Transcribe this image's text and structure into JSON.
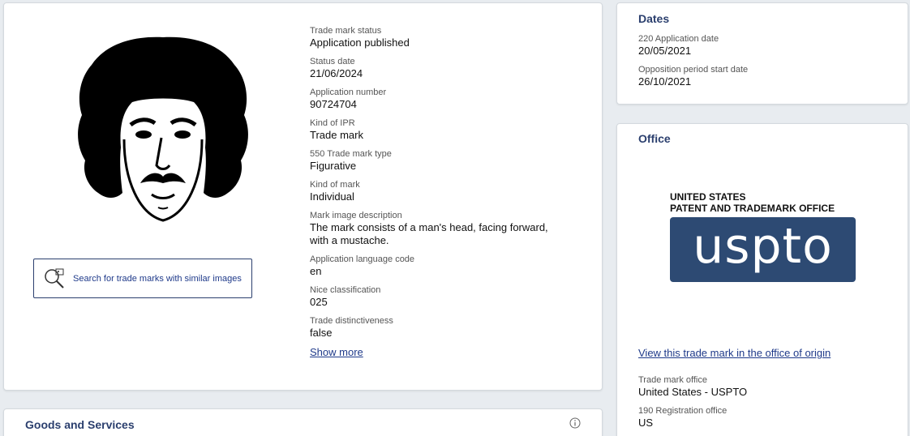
{
  "main_details": {
    "fields": [
      {
        "label": "Trade mark status",
        "value": "Application published"
      },
      {
        "label": "Status date",
        "value": "21/06/2024"
      },
      {
        "label": "Application number",
        "value": "90724704"
      },
      {
        "label": "Kind of IPR",
        "value": "Trade mark"
      },
      {
        "label": "550 Trade mark type",
        "value": "Figurative"
      },
      {
        "label": "Kind of mark",
        "value": "Individual"
      },
      {
        "label": "Mark image description",
        "value": "The mark consists of a man's head, facing forward, with a mustache."
      },
      {
        "label": "Application language code",
        "value": "en"
      },
      {
        "label": "Nice classification",
        "value": "025"
      },
      {
        "label": "Trade distinctiveness",
        "value": "false"
      }
    ],
    "show_more_label": "Show more",
    "similar_search_label": "Search for trade marks with similar images"
  },
  "dates": {
    "title": "Dates",
    "fields": [
      {
        "label": "220 Application date",
        "value": "20/05/2021"
      },
      {
        "label": "Opposition period start date",
        "value": "26/10/2021"
      }
    ]
  },
  "office": {
    "title": "Office",
    "logo_line1": "UNITED STATES",
    "logo_line2": "PATENT AND TRADEMARK OFFICE",
    "logo_word": "uspto",
    "view_origin_label": "View this trade mark in the office of origin",
    "fields": [
      {
        "label": "Trade mark office",
        "value": "United States - USPTO"
      },
      {
        "label": "190 Registration office",
        "value": "US"
      }
    ]
  },
  "goods_services": {
    "title": "Goods and Services",
    "info_icon": "info-icon"
  },
  "colors": {
    "accent": "#2b3f6e",
    "link": "#1f3a8a",
    "uspto_blue": "#2d4a73"
  }
}
